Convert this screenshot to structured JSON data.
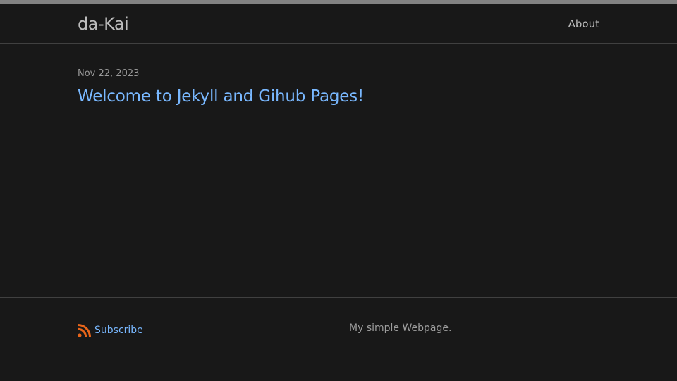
{
  "header": {
    "site_title": "da-Kai",
    "nav": [
      {
        "label": "About"
      }
    ]
  },
  "posts": [
    {
      "date": "Nov 22, 2023",
      "title": "Welcome to Jekyll and Gihub Pages!"
    }
  ],
  "footer": {
    "subscribe_label": "Subscribe",
    "subscribe_icon": "rss-icon",
    "description": "My simple Webpage."
  },
  "colors": {
    "background": "#181818",
    "link": "#79b8ff",
    "text": "#bdbdbd",
    "rss": "#e8651a"
  }
}
